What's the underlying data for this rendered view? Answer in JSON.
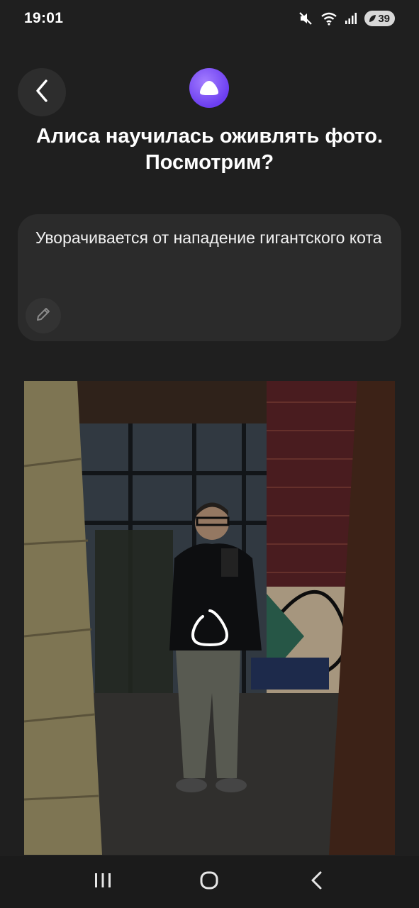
{
  "status_bar": {
    "time": "19:01",
    "battery": "39",
    "icons": [
      "mute-icon",
      "wifi-icon",
      "signal-icon",
      "battery-icon"
    ]
  },
  "header": {
    "back_icon": "chevron-left-icon",
    "logo": "alice-logo",
    "title": "Алиса научилась оживлять фото. Посмотрим?"
  },
  "prompt": {
    "text": "Уворачивается от нападение гигантского кота",
    "edit_icon": "pencil-icon"
  },
  "photo": {
    "state": "loading",
    "spinner_icon": "alice-loading-icon"
  },
  "nav_bar": {
    "recent_icon": "recent-apps-icon",
    "home_icon": "home-icon",
    "back_icon": "back-icon"
  },
  "colors": {
    "background": "#1f1f1f",
    "card": "#2b2b2b",
    "accent": "#7b4df5",
    "text": "#ffffff"
  }
}
